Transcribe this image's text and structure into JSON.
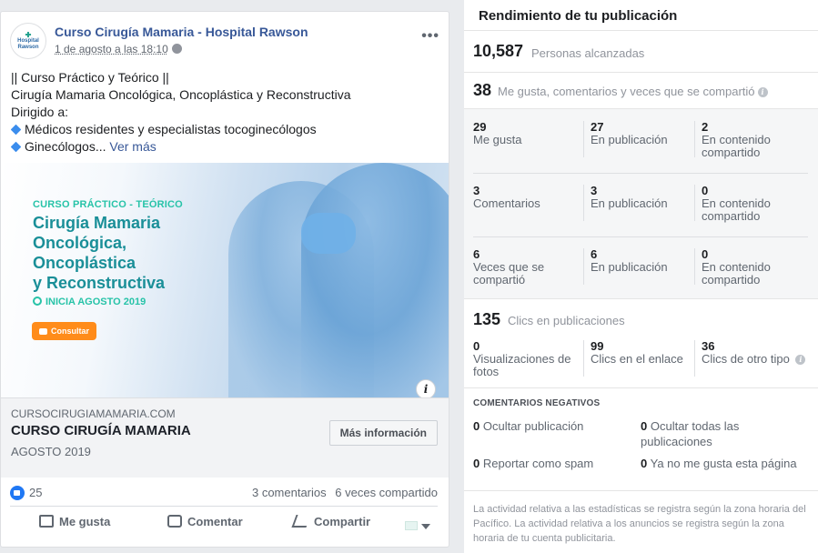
{
  "post": {
    "page_name": "Curso Cirugía Mamaria - Hospital Rawson",
    "avatar_text_line1": "Hospital",
    "avatar_text_line2": "Rawson",
    "timestamp": "1 de agosto a las 18:10",
    "text_line1": "|| Curso Práctico y Teórico ||",
    "text_line2": "Cirugía Mamaria Oncológica, Oncoplástica y Reconstructiva",
    "text_line3": "Dirigido a:",
    "text_line4": "Médicos residentes y especialistas tocoginecólogos",
    "text_line5": "Ginecólogos...",
    "see_more": "Ver más",
    "hero": {
      "subtitle": "CURSO PRÁCTICO - TEÓRICO",
      "title_line1": "Cirugía Mamaria",
      "title_line2": "Oncológica,",
      "title_line3": "Oncoplástica",
      "title_line4": "y Reconstructiva",
      "start": "INICIA AGOSTO 2019",
      "button": "Consultar"
    },
    "link": {
      "domain": "CURSOCIRUGIAMAMARIA.COM",
      "title": "CURSO CIRUGÍA MAMARIA",
      "subtitle": "AGOSTO 2019",
      "cta": "Más información"
    },
    "reactions_count": "25",
    "comments": "3 comentarios",
    "shares": "6 veces compartido",
    "actions": {
      "like": "Me gusta",
      "comment": "Comentar",
      "share": "Compartir"
    }
  },
  "panel": {
    "title": "Rendimiento de tu publicación",
    "reach_value": "10,587",
    "reach_label": "Personas alcanzadas",
    "engagement_value": "38",
    "engagement_label": "Me gusta, comentarios y veces que se compartió",
    "rows": [
      {
        "total": "29",
        "total_label": "Me gusta",
        "on_post": "27",
        "on_post_label": "En publicación",
        "shared": "2",
        "shared_label": "En contenido compartido"
      },
      {
        "total": "3",
        "total_label": "Comentarios",
        "on_post": "3",
        "on_post_label": "En publicación",
        "shared": "0",
        "shared_label": "En contenido compartido"
      },
      {
        "total": "6",
        "total_label": "Veces que se compartió",
        "on_post": "6",
        "on_post_label": "En publicación",
        "shared": "0",
        "shared_label": "En contenido compartido"
      }
    ],
    "clicks_value": "135",
    "clicks_label": "Clics en publicaciones",
    "clicks": [
      {
        "value": "0",
        "label": "Visualizaciones de fotos"
      },
      {
        "value": "99",
        "label": "Clics en el enlace"
      },
      {
        "value": "36",
        "label": "Clics de otro tipo"
      }
    ],
    "negative_title": "COMENTARIOS NEGATIVOS",
    "negative": [
      {
        "value": "0",
        "label": "Ocultar publicación"
      },
      {
        "value": "0",
        "label": "Ocultar todas las publicaciones"
      },
      {
        "value": "0",
        "label": "Reportar como spam"
      },
      {
        "value": "0",
        "label": "Ya no me gusta esta página"
      }
    ],
    "footnote": "La actividad relativa a las estadísticas se registra según la zona horaria del Pacífico. La actividad relativa a los anuncios se registra según la zona horaria de tu cuenta publicitaria."
  },
  "colors": {
    "link_blue": "#385898",
    "hero_teal": "#1a8f98",
    "hero_accent": "#27c3a8",
    "hero_button": "#ff8c1a",
    "like_blue": "#2078f4"
  }
}
